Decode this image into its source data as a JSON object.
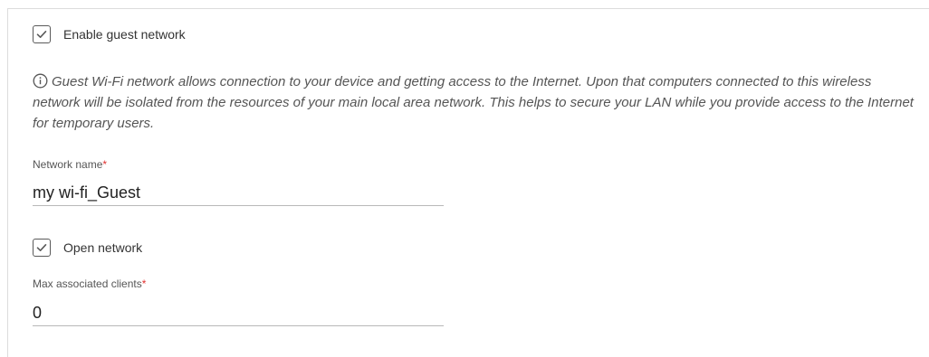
{
  "guest": {
    "enable_label": "Enable guest network",
    "enable_checked": true,
    "info_text": "Guest Wi-Fi network allows connection to your device and getting access to the Internet. Upon that computers connected to this wireless network will be isolated from the resources of your main local area network. This helps to secure your LAN while you provide access to the Internet for temporary users.",
    "info_icon": "info-icon"
  },
  "network_name": {
    "label": "Network name",
    "required_mark": "*",
    "value": "my wi-fi_Guest"
  },
  "open_network": {
    "label": "Open network",
    "checked": true
  },
  "max_clients": {
    "label": "Max associated clients",
    "required_mark": "*",
    "value": "0"
  },
  "colors": {
    "required": "#e0312f",
    "checkbox_border": "#5a5a5a",
    "divider": "#dcdcdc"
  }
}
